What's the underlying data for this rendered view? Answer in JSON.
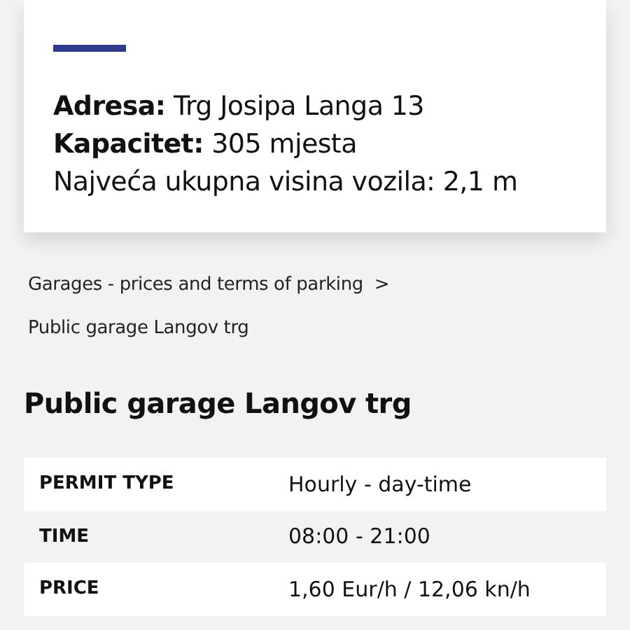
{
  "info_card": {
    "details": [
      "**Adresa:** Trg Josipa Langa 13",
      "**Kapacitet:** 305 mjesta",
      "Najveća ukupna visina vozila: 2,1 m"
    ]
  },
  "breadcrumb": [
    {
      "label": "Garages - prices and terms of parking",
      "separator": ">"
    },
    {
      "label": "Public garage Langov trg"
    }
  ],
  "heading": "Public garage Langov trg",
  "table": {
    "rows": [
      {
        "label": "PERMIT TYPE",
        "value": "Hourly - day-time"
      },
      {
        "label": "TIME",
        "value": "08:00 - 21:00"
      },
      {
        "label": "PRICE",
        "value": "1,60 Eur/h / 12,06 kn/h"
      }
    ]
  }
}
